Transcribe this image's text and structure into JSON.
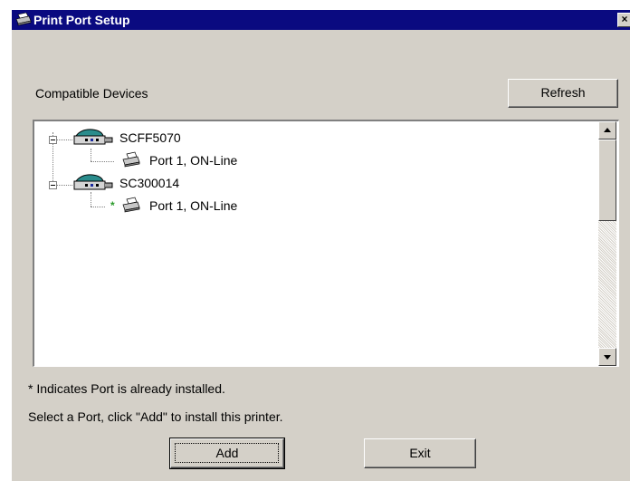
{
  "window": {
    "title": "Print Port Setup",
    "close_glyph": "×"
  },
  "labels": {
    "compatible_devices": "Compatible Devices",
    "note_installed": "* Indicates Port is already installed.",
    "instructions": "Select a Port, click \"Add\" to install this printer."
  },
  "buttons": {
    "refresh": "Refresh",
    "add": "Add",
    "exit": "Exit"
  },
  "tree": {
    "devices": [
      {
        "name": "SCFF5070",
        "icon": "network-device-icon",
        "ports": [
          {
            "label": "Port 1, ON-Line",
            "icon": "printer-icon",
            "installed": false
          }
        ]
      },
      {
        "name": "SC300014",
        "icon": "network-device-icon",
        "ports": [
          {
            "label": "Port 1, ON-Line",
            "icon": "printer-icon",
            "installed": true,
            "installed_glyph": "*"
          }
        ]
      }
    ]
  },
  "colors": {
    "titlebar": "#0a0a80",
    "dialog": "#d4d0c8",
    "device_teal": "#2a8c8c",
    "installed_mark": "#2a9a2a"
  }
}
